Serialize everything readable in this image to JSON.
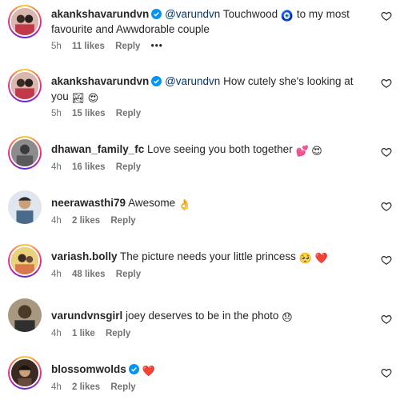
{
  "comments": [
    {
      "username": "akankshavarundvn",
      "verified": true,
      "mention": "@varundvn",
      "text": " Touchwood ",
      "emoji": "🧿",
      "text2": " to my most favourite and Awwdorable couple",
      "time": "5h",
      "likes": "11 likes",
      "reply": "Reply",
      "more": "•••"
    },
    {
      "username": "akankshavarundvn",
      "verified": true,
      "mention": "@varundvn",
      "text": " How cutely she's looking at you ",
      "emoji": "🏞 😍",
      "time": "5h",
      "likes": "15 likes",
      "reply": "Reply"
    },
    {
      "username": "dhawan_family_fc",
      "verified": false,
      "text": " Love seeing you both together ",
      "emoji": "💕 😍",
      "time": "4h",
      "likes": "16 likes",
      "reply": "Reply"
    },
    {
      "username": "neerawasthi79",
      "verified": false,
      "text": " Awesome ",
      "emoji": "👌",
      "time": "4h",
      "likes": "2 likes",
      "reply": "Reply"
    },
    {
      "username": "variash.bolly",
      "verified": false,
      "text": " The picture needs your little princess ",
      "emoji": "🥺 ❤️",
      "time": "4h",
      "likes": "48 likes",
      "reply": "Reply"
    },
    {
      "username": "varundvnsgirl",
      "verified": false,
      "text": " joey deserves to be in the photo ",
      "emoji": "😞",
      "time": "4h",
      "likes": "1 like",
      "reply": "Reply"
    },
    {
      "username": "blossomwolds",
      "verified": true,
      "text": " ",
      "emoji": "❤️",
      "time": "4h",
      "likes": "2 likes",
      "reply": "Reply"
    }
  ],
  "colors": {
    "text": "#262626",
    "meta": "#737373",
    "mention": "#00376b",
    "verified": "#0095f6"
  },
  "icons": {
    "like": "heart-outline-icon",
    "verified": "verified-badge-icon"
  }
}
